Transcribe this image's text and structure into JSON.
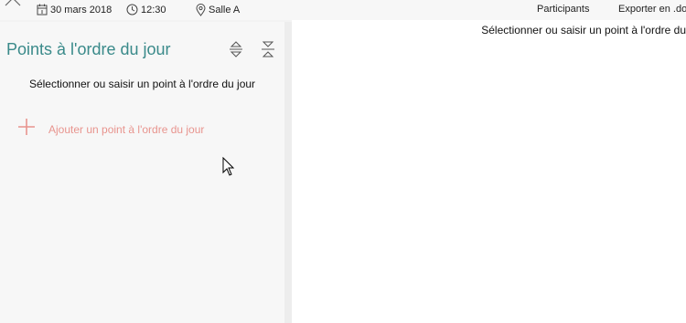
{
  "header": {
    "date": "30 mars 2018",
    "time": "12:30",
    "location": "Salle A",
    "participants_label": "Participants",
    "export_label": "Exporter en .do",
    "icons": [
      "chevron-up-icon",
      "calendar-icon",
      "clock-icon",
      "location-pin-icon"
    ]
  },
  "agenda": {
    "title": "Points à l'ordre du jour",
    "hint": "Sélectionner ou saisir un point à l'ordre du jour",
    "add_label": "Ajouter un point à l'ordre du jour",
    "icons": [
      "expand-all-icon",
      "collapse-all-icon",
      "plus-icon"
    ]
  },
  "detail": {
    "hint": "Sélectionner ou saisir un point à l'ordre du"
  },
  "colors": {
    "title_teal": "#3a8a8a",
    "add_accent": "#e8948e",
    "panel_bg": "#f7f7f7",
    "detail_bg": "#ffffff"
  }
}
